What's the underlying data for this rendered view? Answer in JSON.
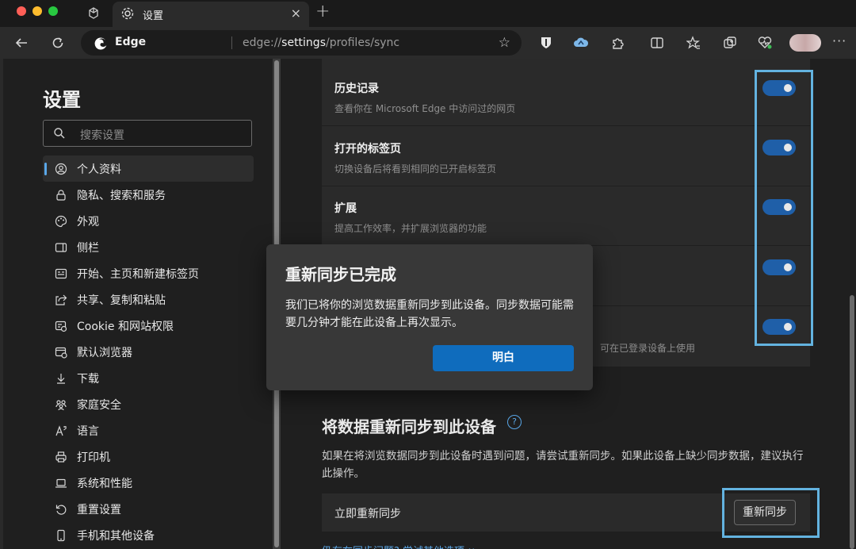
{
  "tab": {
    "title": "设置",
    "close": "×",
    "new_tab": "+"
  },
  "address": {
    "edge_label": "Edge",
    "url_prefix": "edge://",
    "url_bold": "settings",
    "url_suffix": "/profiles/sync"
  },
  "sidebar": {
    "title": "设置",
    "search_placeholder": "搜索设置",
    "items": [
      {
        "label": "个人资料",
        "icon": "profile-icon",
        "active": true
      },
      {
        "label": "隐私、搜索和服务",
        "icon": "lock-icon"
      },
      {
        "label": "外观",
        "icon": "palette-icon"
      },
      {
        "label": "侧栏",
        "icon": "sidebar-icon"
      },
      {
        "label": "开始、主页和新建标签页",
        "icon": "home-icon"
      },
      {
        "label": "共享、复制和粘贴",
        "icon": "share-icon"
      },
      {
        "label": "Cookie 和网站权限",
        "icon": "site-permissions-icon"
      },
      {
        "label": "默认浏览器",
        "icon": "browser-icon"
      },
      {
        "label": "下载",
        "icon": "download-icon"
      },
      {
        "label": "家庭安全",
        "icon": "family-icon"
      },
      {
        "label": "语言",
        "icon": "language-icon"
      },
      {
        "label": "打印机",
        "icon": "printer-icon"
      },
      {
        "label": "系统和性能",
        "icon": "laptop-icon"
      },
      {
        "label": "重置设置",
        "icon": "reset-icon"
      },
      {
        "label": "手机和其他设备",
        "icon": "phone-icon"
      }
    ]
  },
  "sync": {
    "rows": [
      {
        "title": "历史记录",
        "desc": "查看你在 Microsoft Edge 中访问过的网页",
        "on": true
      },
      {
        "title": "打开的标签页",
        "desc": "切换设备后将看到相同的已开启标签页",
        "on": true
      },
      {
        "title": "扩展",
        "desc": "提高工作效率，并扩展浏览器的功能",
        "on": true
      },
      {
        "title": "",
        "desc": "",
        "on": true
      },
      {
        "title": "",
        "desc": "可在已登录设备上使用",
        "on": true
      }
    ]
  },
  "resync": {
    "section_title": "将数据重新同步到此设备",
    "help": "?",
    "desc": "如果在将浏览数据同步到此设备时遇到问题，请尝试重新同步。如果此设备上缺少同步数据，建议执行此操作。",
    "row_label": "立即重新同步",
    "button": "重新同步",
    "footer_link": "仍存在同步问题? 尝试其他选项 ∨"
  },
  "dialog": {
    "title": "重新同步已完成",
    "body": "我们已将你的浏览数据重新同步到此设备。同步数据可能需要几分钟才能在此设备上再次显示。",
    "ok": "明白"
  },
  "colors": {
    "accent": "#0f6cbd",
    "highlight": "#63b3e0",
    "toggle_on": "#1f5fa8"
  }
}
